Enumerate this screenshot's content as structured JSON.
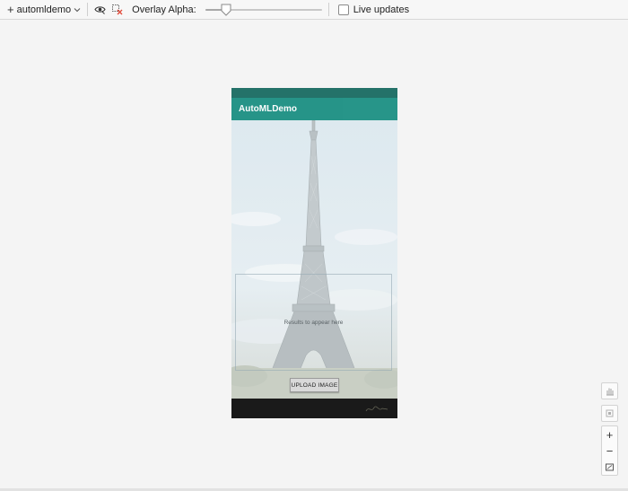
{
  "toolbar": {
    "add_icon": "plus-icon",
    "process_label": "automldemo",
    "dropdown_icon": "chevron-down-icon",
    "eye_icon": "eye-icon",
    "overlay_clear_icon": "overlay-clear-icon",
    "overlay_alpha_label": "Overlay Alpha:",
    "overlay_alpha_value": 0.18,
    "live_updates_label": "Live updates",
    "live_updates_checked": false
  },
  "device": {
    "app_title": "AutoMLDemo",
    "results_placeholder": "Results to appear here",
    "upload_button_label": "UPLOAD IMAGE"
  },
  "side_controls": {
    "pan_icon": "hand-icon",
    "layout_icon": "layout-icon",
    "zoom_in": "+",
    "zoom_out": "−",
    "fit_icon": "fit-screen-icon"
  },
  "colors": {
    "appbar": "#178d80",
    "statusbar": "#14675d",
    "navbar": "#1a1a1a",
    "sky": "#dfeaf0"
  }
}
